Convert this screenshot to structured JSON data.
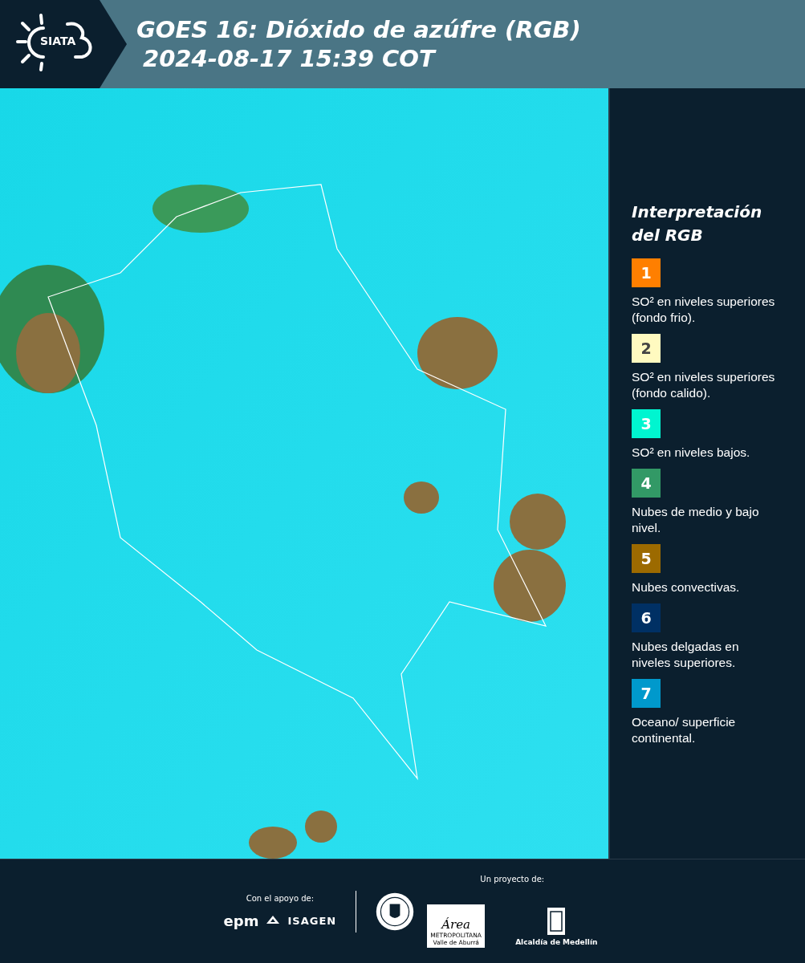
{
  "header": {
    "logo_text": "SIATA",
    "title": "GOES 16: Dióxido de azúfre (RGB)",
    "timestamp": "2024-08-17 15:39 COT"
  },
  "legend": {
    "title": "Interpretación del RGB",
    "items": [
      {
        "number": "1",
        "color": "#ff7f00",
        "text": "SO² en niveles superiores (fondo frio)."
      },
      {
        "number": "2",
        "color": "#fffac0",
        "text": "SO² en niveles superiores (fondo calido)."
      },
      {
        "number": "3",
        "color": "#00f5d0",
        "text": "SO² en niveles bajos."
      },
      {
        "number": "4",
        "color": "#329966",
        "text": "Nubes de medio y bajo nivel."
      },
      {
        "number": "5",
        "color": "#9c6a00",
        "text": "Nubes convectivas."
      },
      {
        "number": "6",
        "color": "#003064",
        "text": "Nubes delgadas en niveles superiores."
      },
      {
        "number": "7",
        "color": "#0099cc",
        "text": "Oceano/ superficie continental."
      }
    ]
  },
  "footer": {
    "support_label": "Con el apoyo de:",
    "support_logos": [
      "epm",
      "ISAGEN"
    ],
    "project_label": "Un proyecto de:",
    "area_logo": {
      "script": "Área",
      "line1": "METROPOLITANA",
      "line2": "Valle de Aburrá"
    },
    "alcaldia_label": "Alcaldía de Medellín"
  }
}
